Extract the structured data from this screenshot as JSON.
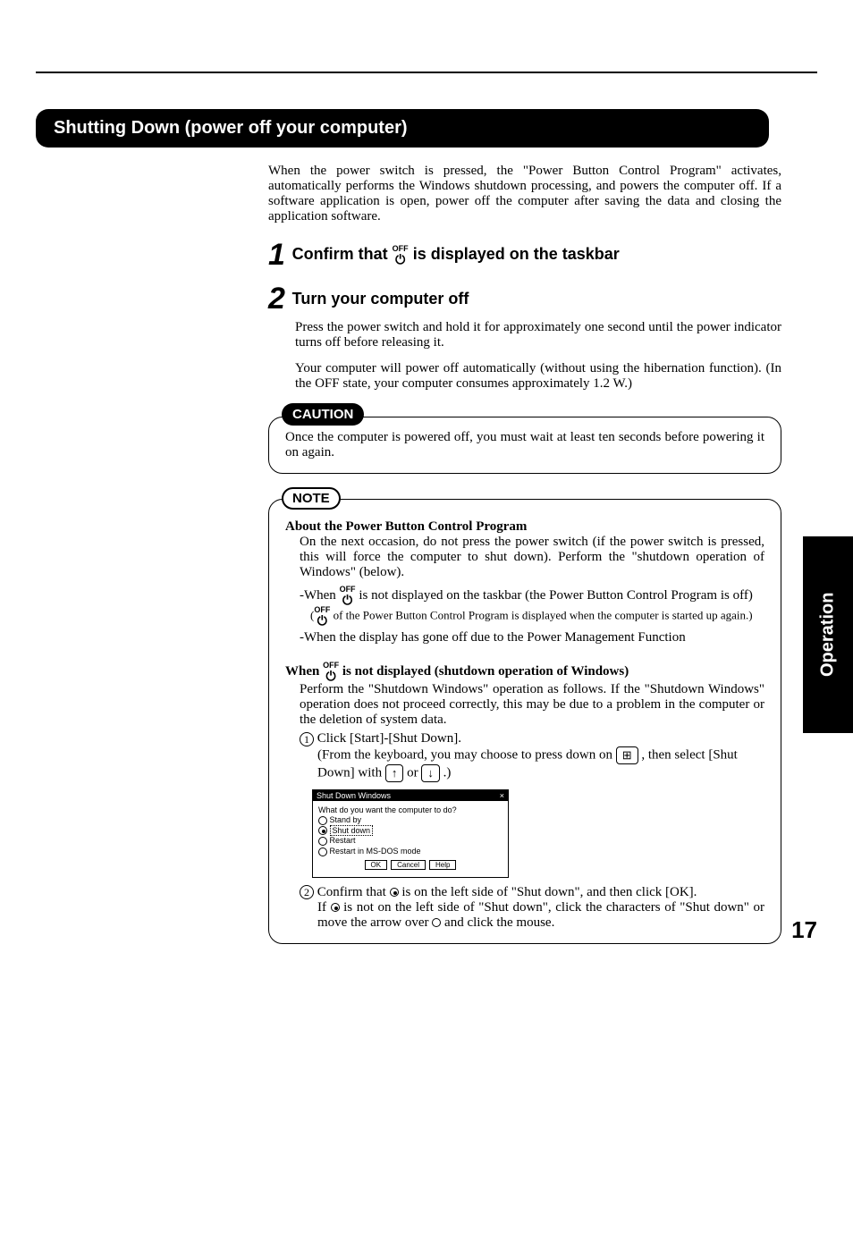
{
  "page": {
    "sectionHeader": "Shutting Down (power off your computer)",
    "sideTab": "Operation",
    "pageNumber": "17"
  },
  "intro": "When the power switch is pressed, the \"Power Button Control Program\" activates, automatically performs the Windows shutdown processing, and powers the computer off. If a software application is open, power off the computer after saving the data and closing the application software.",
  "steps": {
    "one": {
      "num": "1",
      "titlePre": "Confirm that ",
      "titlePost": " is displayed on the taskbar"
    },
    "two": {
      "num": "2",
      "title": "Turn your computer off",
      "body1": "Press the power switch and hold it for approximately one second until the power indicator turns off before releasing it.",
      "body2": "Your computer will power off automatically (without using the hibernation function). (In the OFF state, your computer consumes approximately 1.2 W.)"
    }
  },
  "caution": {
    "label": "CAUTION",
    "text": "Once the computer is powered off, you must wait at least ten seconds before powering it on again."
  },
  "note": {
    "label": "NOTE",
    "h1": "About the Power Button Control Program",
    "p1": "On the next occasion, do not press the power switch (if the power switch is pressed, this will force the computer to shut down). Perform the \"shutdown operation of Windows\" (below).",
    "p2pre": "-When ",
    "p2post": " is not displayed on the taskbar (the Power Button Control Program is off)",
    "p2sub": " of the Power Button Control Program is displayed when the computer is started up again.)",
    "p3": "-When the display has gone off due to the Power Management Function",
    "h2pre": "When ",
    "h2post": " is not displayed (shutdown operation of Windows)",
    "p4": "Perform the \"Shutdown Windows\" operation as follows. If the \"Shutdown Windows\" operation does not proceed correctly, this may be due to a problem in the computer or the deletion of system data.",
    "li1": "Click [Start]-[Shut Down].",
    "li1a_pre": "(From the keyboard, you may choose to press down on ",
    "li1a_mid": " , then select [Shut Down] with ",
    "li1a_or": " or ",
    "li1a_end": " .)",
    "li2pre": "Confirm that ",
    "li2mid": " is on the left side of \"Shut down\", and then click [OK].",
    "li2b_pre": "If ",
    "li2b_mid": " is not on the left side of \"Shut down\", click the characters of \"Shut down\" or move the arrow over ",
    "li2b_end": " and click the mouse."
  },
  "dialog": {
    "title": "Shut Down Windows",
    "prompt": "What do you want the computer to do?",
    "opt1": "Stand by",
    "opt2": "Shut down",
    "opt3": "Restart",
    "opt4": "Restart in MS-DOS mode",
    "btnOk": "OK",
    "btnCancel": "Cancel",
    "btnHelp": "Help"
  },
  "icons": {
    "offLabel": "OFF",
    "power": "⏻",
    "winKey": "⊞",
    "up": "↑",
    "down": "↓",
    "circ1": "1",
    "circ2": "2"
  }
}
